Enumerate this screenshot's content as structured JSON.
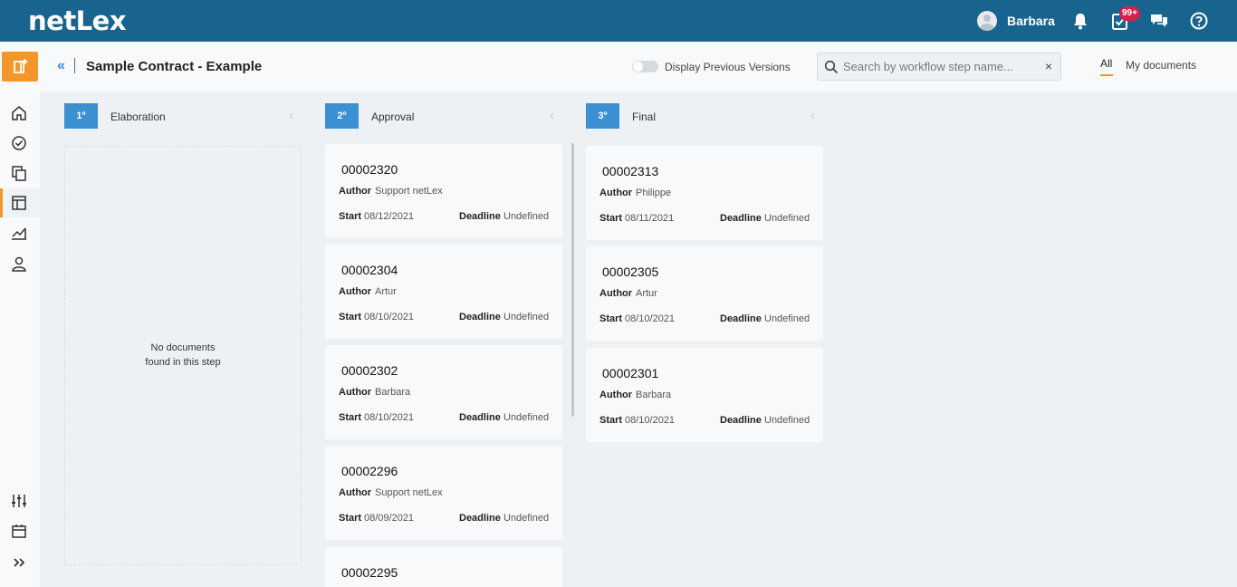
{
  "app": {
    "logo": "netLex",
    "user_name": "Barbara",
    "notifications_badge": "99+"
  },
  "header": {
    "title": "Sample Contract - Example",
    "toggle_label": "Display Previous Versions",
    "toggle_on": false,
    "search_placeholder": "Search by workflow step name...",
    "search_value": "",
    "clear_symbol": "×",
    "tabs": [
      {
        "label": "All",
        "active": true
      },
      {
        "label": "My documents",
        "active": false
      }
    ]
  },
  "sidebar": {
    "items": [
      "home-icon",
      "dashboard-icon",
      "documents-icon",
      "workflow-icon",
      "analytics-icon",
      "user-icon"
    ],
    "bottom_items": [
      "settings-sliders-icon",
      "calendar-icon",
      "expand-icon"
    ],
    "active_item": "workflow-icon"
  },
  "steps": [
    {
      "number": "1º",
      "name": "Elaboration",
      "empty_text_line1": "No documents",
      "empty_text_line2": "found in this step",
      "cards": []
    },
    {
      "number": "2º",
      "name": "Approval",
      "cards": [
        {
          "id": "00002320",
          "author": "Support netLex",
          "start": "08/12/2021",
          "deadline": "Undefined"
        },
        {
          "id": "00002304",
          "author": "Artur",
          "start": "08/10/2021",
          "deadline": "Undefined"
        },
        {
          "id": "00002302",
          "author": "Barbara",
          "start": "08/10/2021",
          "deadline": "Undefined"
        },
        {
          "id": "00002296",
          "author": "Support netLex",
          "start": "08/09/2021",
          "deadline": "Undefined"
        },
        {
          "id": "00002295"
        }
      ]
    },
    {
      "number": "3º",
      "name": "Final",
      "cards": [
        {
          "id": "00002313",
          "author": "Philippe",
          "start": "08/11/2021",
          "deadline": "Undefined"
        },
        {
          "id": "00002305",
          "author": "Artur",
          "start": "08/10/2021",
          "deadline": "Undefined"
        },
        {
          "id": "00002301",
          "author": "Barbara",
          "start": "08/10/2021",
          "deadline": "Undefined"
        }
      ]
    }
  ],
  "labels": {
    "author": "Author",
    "start": "Start",
    "deadline": "Deadline"
  },
  "colors": {
    "topbar": "#18648f",
    "accent": "#f3972a",
    "step_badge": "#3a90d0",
    "notification_badge": "#d9204b"
  }
}
